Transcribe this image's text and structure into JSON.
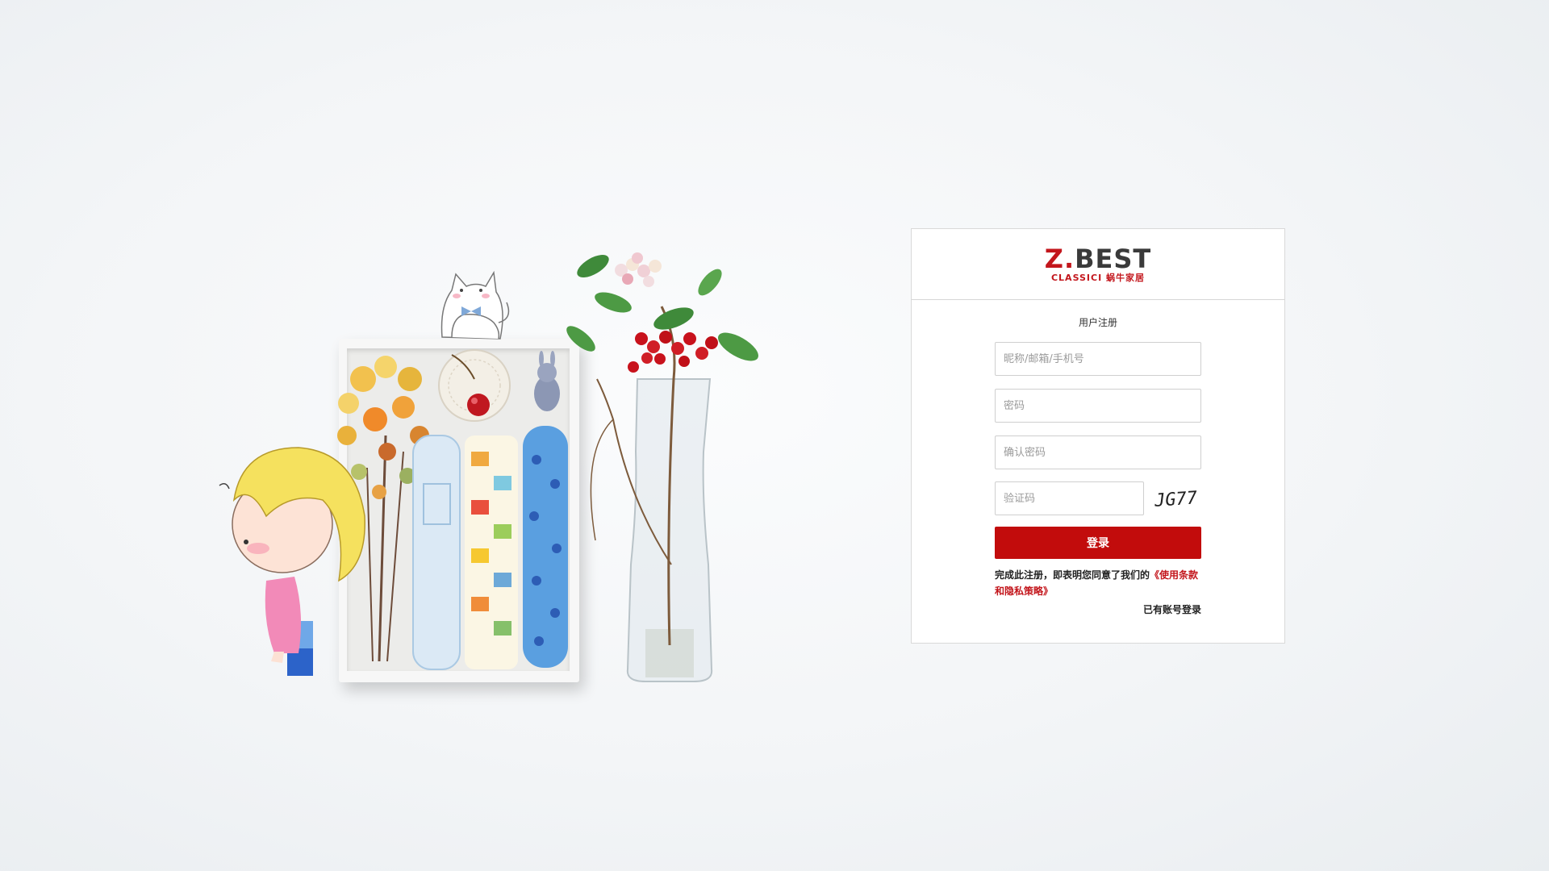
{
  "brand": {
    "logo_main_z": "Z.",
    "logo_main_rest": "BEST",
    "logo_sub": "CLASSICI 蜗牛家居",
    "accent_color": "#c3161c"
  },
  "form": {
    "title": "用户注册",
    "nickname_placeholder": "昵称/邮箱/手机号",
    "password_placeholder": "密码",
    "confirm_password_placeholder": "确认密码",
    "captcha_placeholder": "验证码",
    "captcha_text": "JG77",
    "submit_label": "登录",
    "terms_prefix": "完成此注册，即表明您同意了我们的",
    "terms_link": "《使用条款和隐私策略》",
    "login_link": "已有账号登录",
    "button_color": "#c20c0c"
  },
  "background": {
    "icons": [
      "girl-icon",
      "cat-icon",
      "flower-bouquet-icon",
      "vase-icon",
      "gift-box-icon"
    ]
  }
}
